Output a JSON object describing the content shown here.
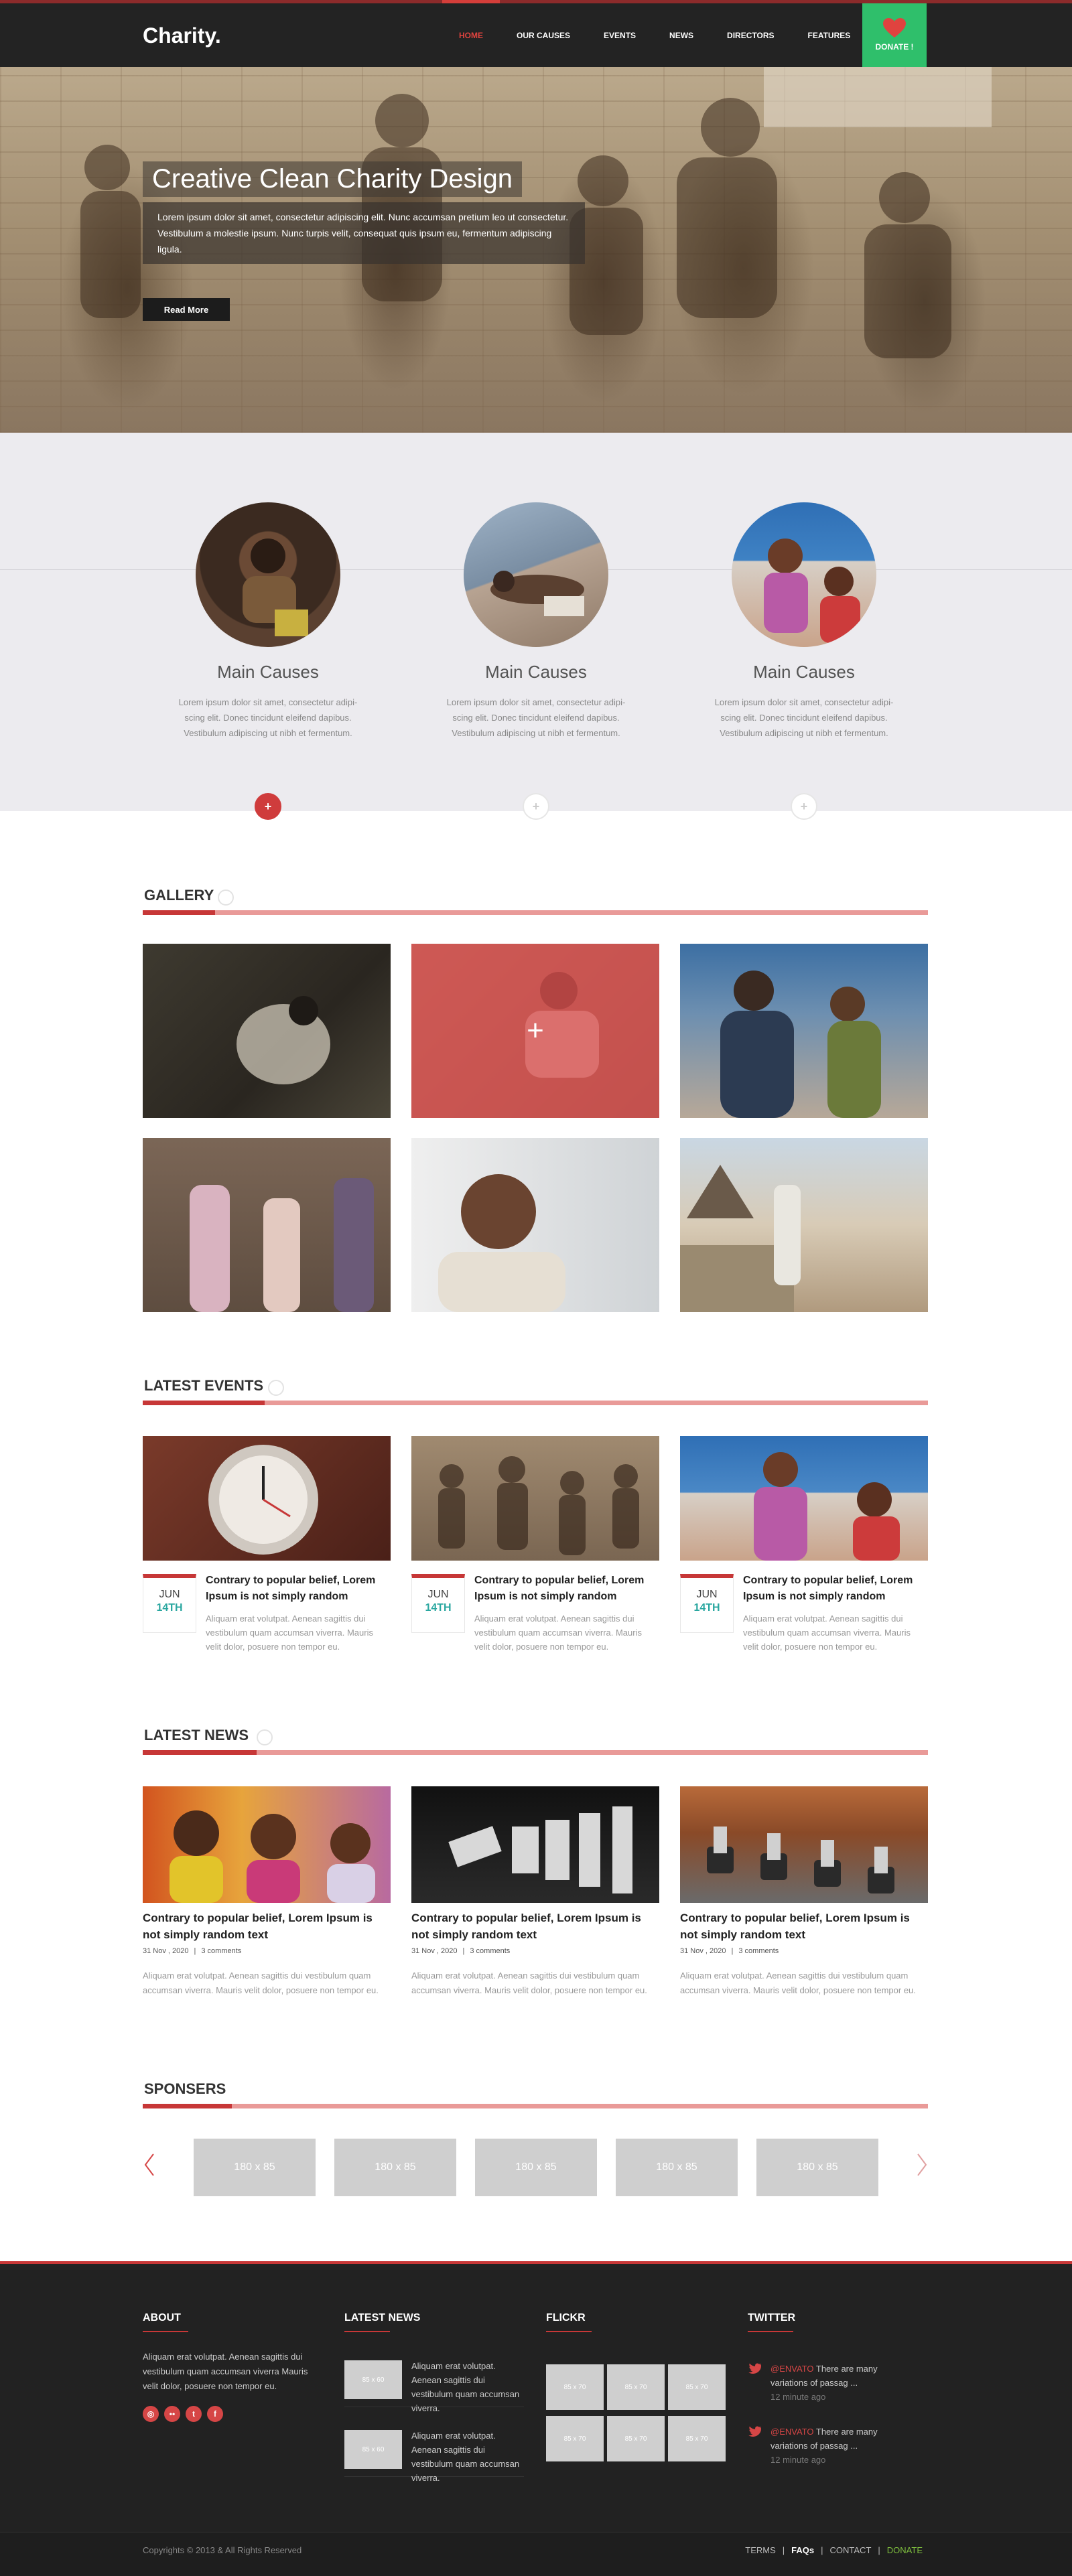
{
  "header": {
    "logo": "Charity.",
    "nav": [
      "HOME",
      "OUR CAUSES",
      "EVENTS",
      "NEWS",
      "DIRECTORS",
      "FEATURES"
    ],
    "donate_label": "DONATE !"
  },
  "hero": {
    "title": "Creative Clean Charity Design",
    "text": "Lorem ipsum dolor sit amet, consectetur adipiscing elit. Nunc accumsan pretium leo ut consectetur. Vestibulum a molestie ipsum. Nunc turpis velit, consequat quis ipsum eu, fermentum adipiscing ligula.",
    "button": "Read More"
  },
  "causes": [
    {
      "title": "Main Causes",
      "text": "Lorem ipsum dolor sit amet, consectetur adipi-scing elit. Donec tincidunt eleifend dapibus. Vestibulum adipiscing ut nibh et fermentum."
    },
    {
      "title": "Main Causes",
      "text": "Lorem ipsum dolor sit amet, consectetur adipi-scing elit. Donec tincidunt eleifend dapibus. Vestibulum adipiscing ut nibh et fermentum."
    },
    {
      "title": "Main Causes",
      "text": "Lorem ipsum dolor sit amet, consectetur adipi-scing elit. Donec tincidunt eleifend dapibus. Vestibulum adipiscing ut nibh et fermentum."
    }
  ],
  "causes_dot_glyph": "+",
  "gallery": {
    "title": "GALLERY",
    "overlay_glyph": "+"
  },
  "events": {
    "title": "LATEST EVENTS",
    "items": [
      {
        "month": "JUN",
        "day": "14TH",
        "title": "Contrary to popular belief, Lorem Ipsum is not simply random",
        "text": "Aliquam erat volutpat. Aenean sagittis dui vestibulum quam accumsan viverra. Mauris velit dolor, posuere non tempor eu."
      },
      {
        "month": "JUN",
        "day": "14TH",
        "title": "Contrary to popular belief, Lorem Ipsum is not simply random",
        "text": "Aliquam erat volutpat. Aenean sagittis dui vestibulum quam accumsan viverra. Mauris velit dolor, posuere non tempor eu."
      },
      {
        "month": "JUN",
        "day": "14TH",
        "title": "Contrary to popular belief, Lorem Ipsum is not simply random",
        "text": "Aliquam erat volutpat. Aenean sagittis dui vestibulum quam accumsan viverra. Mauris velit dolor, posuere non tempor eu."
      }
    ]
  },
  "news": {
    "title": "LATEST NEWS",
    "items": [
      {
        "title": "Contrary to popular belief, Lorem Ipsum is not simply random text",
        "date": "31 Nov , 2020",
        "comments": "3 comments",
        "text": "Aliquam erat volutpat. Aenean sagittis dui vestibulum quam accumsan viverra. Mauris velit dolor, posuere non tempor eu."
      },
      {
        "title": "Contrary to popular belief, Lorem Ipsum is not simply random text",
        "date": "31 Nov , 2020",
        "comments": "3 comments",
        "text": "Aliquam erat volutpat. Aenean sagittis dui vestibulum quam accumsan viverra. Mauris velit dolor, posuere non tempor eu."
      },
      {
        "title": "Contrary to popular belief, Lorem Ipsum is not simply random text",
        "date": "31 Nov , 2020",
        "comments": "3 comments",
        "text": "Aliquam erat volutpat. Aenean sagittis dui vestibulum quam accumsan viverra. Mauris velit dolor, posuere non tempor eu."
      }
    ]
  },
  "meta_separator": "|",
  "sponsors": {
    "title": "SPONSERS",
    "boxes": [
      "180 x 85",
      "180 x 85",
      "180 x 85",
      "180 x 85",
      "180 x 85"
    ]
  },
  "footer": {
    "about": {
      "title": "ABOUT",
      "text": "Aliquam erat volutpat. Aenean sagittis dui vestibulum quam accumsan viverra Mauris velit dolor, posuere non tempor eu.",
      "social": [
        "instagram-icon",
        "flickr-icon",
        "tumblr-icon",
        "facebook-icon"
      ],
      "social_glyphs": [
        "◎",
        "••",
        "t",
        "f"
      ]
    },
    "latest_news": {
      "title": "LATEST NEWS",
      "items": [
        {
          "thumb": "85 x 60",
          "text": "Aliquam erat volutpat. Aenean sagittis dui vestibulum quam accumsan viverra."
        },
        {
          "thumb": "85 x 60",
          "text": "Aliquam erat volutpat. Aenean sagittis dui vestibulum quam accumsan viverra."
        }
      ]
    },
    "flickr": {
      "title": "FLICKR",
      "thumbs": [
        "85 x 70",
        "85 x 70",
        "85 x 70",
        "85 x 70",
        "85 x 70",
        "85 x 70"
      ]
    },
    "twitter": {
      "title": "TWITTER",
      "items": [
        {
          "handle": "@ENVATO",
          "text": " There are many variations of passag ...",
          "time": "12 minute ago"
        },
        {
          "handle": "@ENVATO",
          "text": " There are many variations of passag ...",
          "time": "12 minute ago"
        }
      ]
    },
    "copyright": "Copyrights © 2013 & All Rights Reserved",
    "links": [
      "TERMS",
      "FAQs",
      "CONTACT",
      "DONATE"
    ],
    "link_separator": "|"
  },
  "colors": {
    "accent": "#c73737",
    "donate": "#2fbf6b",
    "date_day": "#2aa7a0",
    "dark": "#222222"
  }
}
